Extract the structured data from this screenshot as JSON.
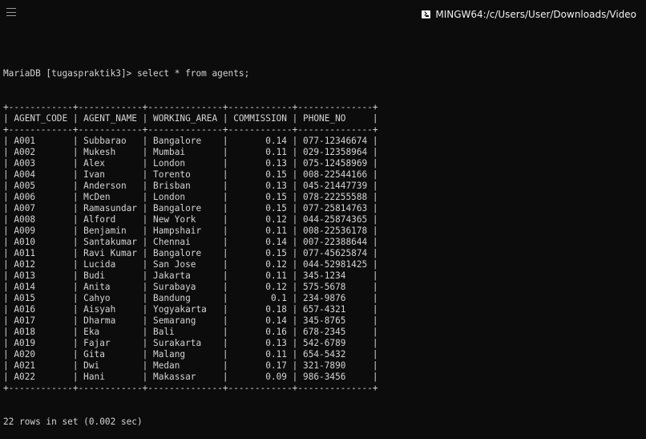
{
  "window": {
    "title": "MINGW64:/c/Users/User/Downloads/Video",
    "icon": "terminal-icon",
    "menu_icon": "hamburger-menu-icon"
  },
  "terminal": {
    "prompt": "MariaDB [tugaspraktik3]>",
    "command": "select * from agents;",
    "columns": [
      "AGENT_CODE",
      "AGENT_NAME",
      "WORKING_AREA",
      "COMMISSION",
      "PHONE_NO"
    ],
    "rows": [
      [
        "A001",
        "Subbarao",
        "Bangalore",
        "0.14",
        "077-12346674"
      ],
      [
        "A002",
        "Mukesh",
        "Mumbai",
        "0.11",
        "029-12358964"
      ],
      [
        "A003",
        "Alex",
        "London",
        "0.13",
        "075-12458969"
      ],
      [
        "A004",
        "Ivan",
        "Torento",
        "0.15",
        "008-22544166"
      ],
      [
        "A005",
        "Anderson",
        "Brisban",
        "0.13",
        "045-21447739"
      ],
      [
        "A006",
        "McDen",
        "London",
        "0.15",
        "078-22255588"
      ],
      [
        "A007",
        "Ramasundar",
        "Bangalore",
        "0.15",
        "077-25814763"
      ],
      [
        "A008",
        "Alford",
        "New York",
        "0.12",
        "044-25874365"
      ],
      [
        "A009",
        "Benjamin",
        "Hampshair",
        "0.11",
        "008-22536178"
      ],
      [
        "A010",
        "Santakumar",
        "Chennai",
        "0.14",
        "007-22388644"
      ],
      [
        "A011",
        "Ravi Kumar",
        "Bangalore",
        "0.15",
        "077-45625874"
      ],
      [
        "A012",
        "Lucida",
        "San Jose",
        "0.12",
        "044-52981425"
      ],
      [
        "A013",
        "Budi",
        "Jakarta",
        "0.11",
        "345-1234"
      ],
      [
        "A014",
        "Anita",
        "Surabaya",
        "0.12",
        "575-5678"
      ],
      [
        "A015",
        "Cahyo",
        "Bandung",
        "0.1",
        "234-9876"
      ],
      [
        "A016",
        "Aisyah",
        "Yogyakarta",
        "0.18",
        "657-4321"
      ],
      [
        "A017",
        "Dharma",
        "Semarang",
        "0.14",
        "345-8765"
      ],
      [
        "A018",
        "Eka",
        "Bali",
        "0.16",
        "678-2345"
      ],
      [
        "A019",
        "Fajar",
        "Surakarta",
        "0.13",
        "542-6789"
      ],
      [
        "A020",
        "Gita",
        "Malang",
        "0.11",
        "654-5432"
      ],
      [
        "A021",
        "Dwi",
        "Medan",
        "0.17",
        "321-7890"
      ],
      [
        "A022",
        "Hani",
        "Makassar",
        "0.09",
        "986-3456"
      ]
    ],
    "summary": "22 rows in set (0.002 sec)"
  },
  "colors": {
    "background": "#0c0c0c",
    "text": "#d4d4d4",
    "title_text": "#f0f0f0"
  }
}
